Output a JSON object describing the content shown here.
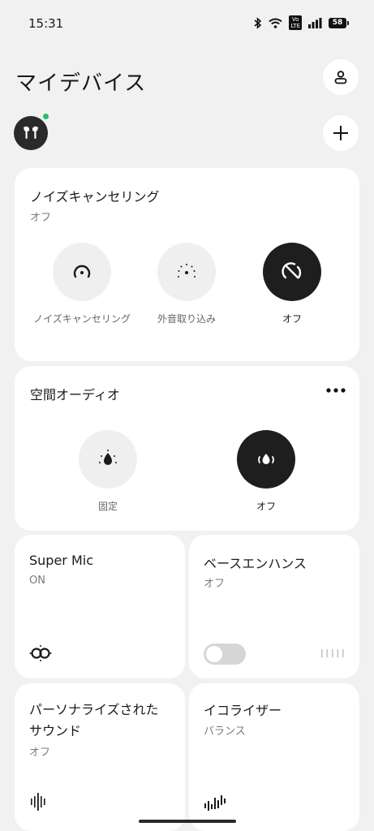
{
  "status": {
    "time": "15:31",
    "volte": "Vo\nLTE",
    "battery": "58"
  },
  "header": {
    "title": "マイデバイス"
  },
  "anc": {
    "title": "ノイズキャンセリング",
    "state": "オフ",
    "modes": [
      {
        "label": "ノイズキャンセリング",
        "icon": "noise-cancel-icon",
        "active": false
      },
      {
        "label": "外音取り込み",
        "icon": "ambient-icon",
        "active": false
      },
      {
        "label": "オフ",
        "icon": "anc-off-icon",
        "active": true
      }
    ]
  },
  "spatial": {
    "title": "空間オーディオ",
    "modes": [
      {
        "label": "固定",
        "icon": "spatial-fixed-icon",
        "active": false
      },
      {
        "label": "オフ",
        "icon": "spatial-off-icon",
        "active": true
      }
    ]
  },
  "super_mic": {
    "title": "Super Mic",
    "state": "ON",
    "icon": "super-mic-icon"
  },
  "bass": {
    "title": "ベースエンハンス",
    "state": "オフ",
    "toggle_on": false,
    "icon": "bass-level-icon"
  },
  "personalized": {
    "title": "パーソナライズされた\nサウンド",
    "state": "オフ",
    "icon": "waveform-icon"
  },
  "equalizer": {
    "title": "イコライザー",
    "state": "バランス",
    "icon": "equalizer-icon"
  },
  "colors": {
    "background": "#f1f1f1",
    "card": "#ffffff",
    "active": "#1e1e1e",
    "online": "#1fc16b"
  }
}
